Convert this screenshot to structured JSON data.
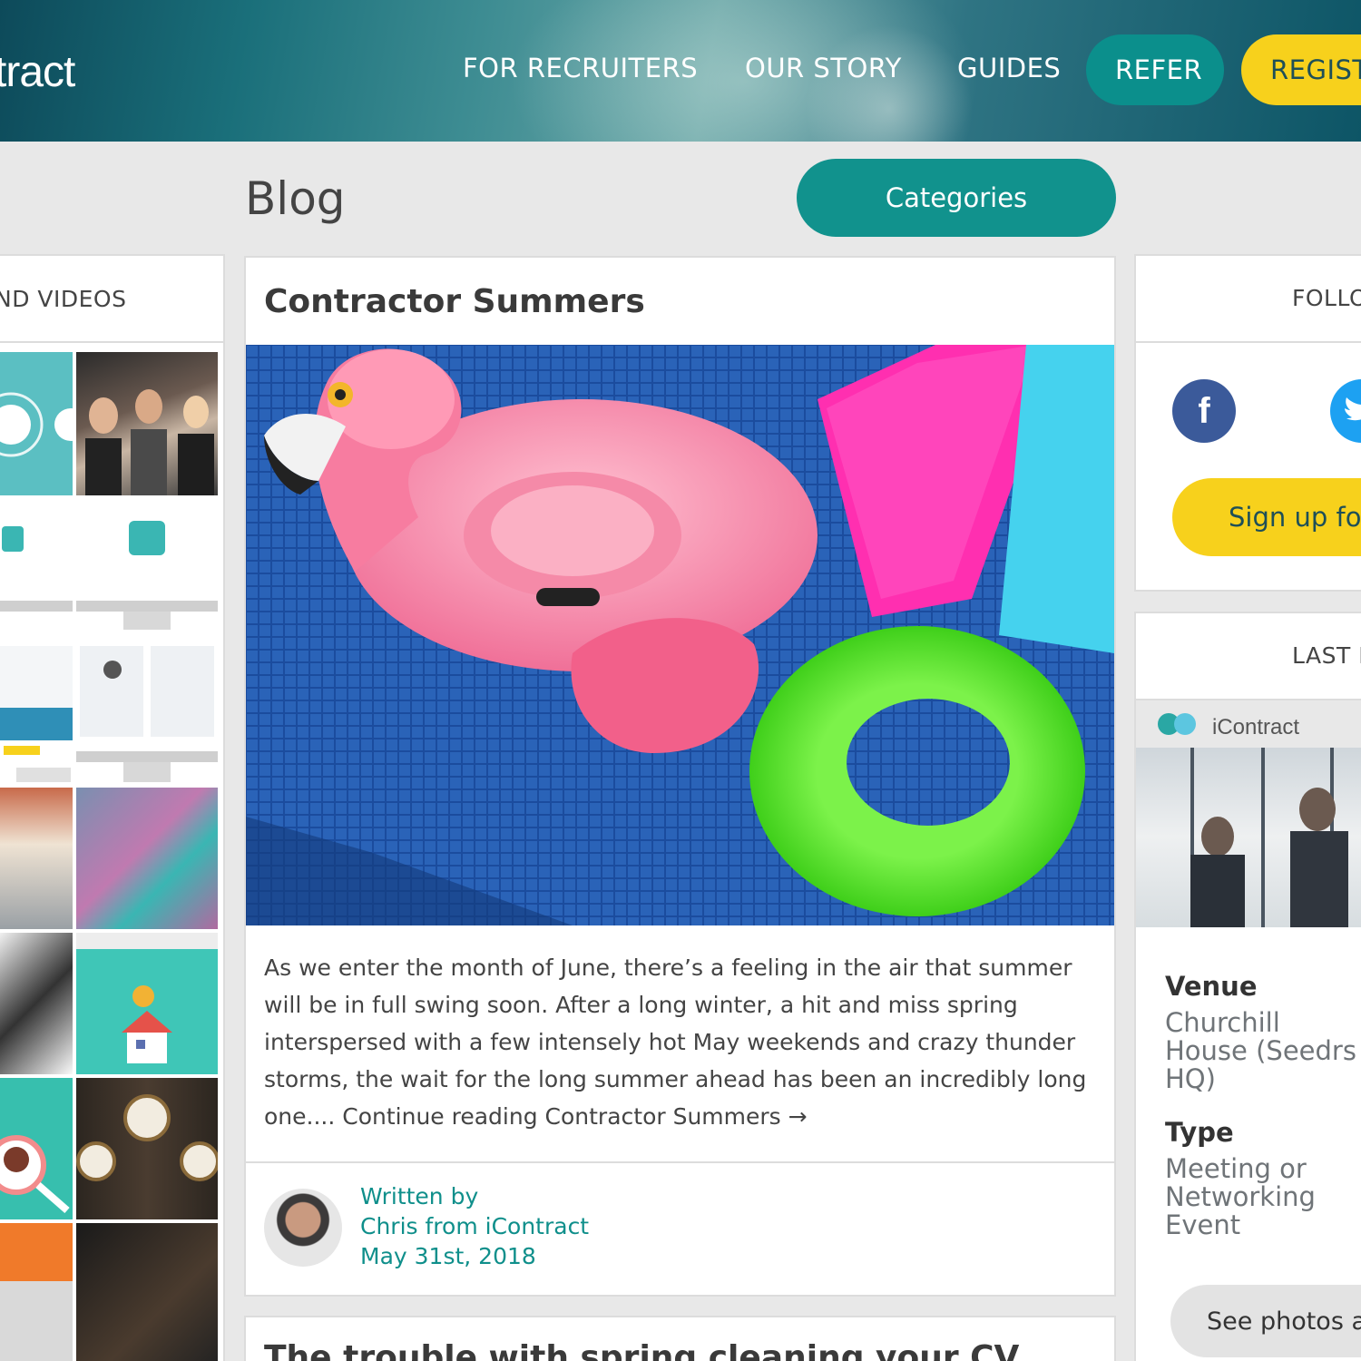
{
  "header": {
    "logo": "tract",
    "nav": {
      "recruiters": "FOR RECRUITERS",
      "story": "OUR STORY",
      "guides": "GUIDES",
      "refer": "REFER",
      "register": "REGIST"
    }
  },
  "blog": {
    "title": "Blog",
    "categories_label": "Categories"
  },
  "left_panel": {
    "heading": "ND VIDEOS"
  },
  "post": {
    "title": "Contractor Summers",
    "excerpt": "As we enter the month of June, there’s a feeling in the air that summer will be in full swing soon. After a long winter, a hit and miss spring interspersed with a few intensely hot May weekends and crazy thunder storms, the wait for the long summer ahead has been an incredibly long one.... Continue reading Contractor Summers →",
    "written_by": "Written by",
    "author": "Chris from iContract",
    "date": "May 31st, 2018"
  },
  "next_post": {
    "title": "The trouble with spring cleaning your CV"
  },
  "follow": {
    "heading": "FOLLO",
    "facebook_glyph": "f",
    "signup_label": "Sign up for"
  },
  "event": {
    "heading": "LAST E",
    "brand": "iContract",
    "venue_label": "Venue",
    "venue_value": "Churchill House (Seedrs HQ)",
    "type_label": "Type",
    "type_value": "Meeting or Networking Event",
    "photos_label": "See photos a"
  },
  "colors": {
    "teal": "#11928d",
    "yellow": "#f7d11c",
    "facebook": "#3b5a9a",
    "twitter": "#1da1f2"
  },
  "icons": [
    "facebook-icon",
    "twitter-icon"
  ]
}
